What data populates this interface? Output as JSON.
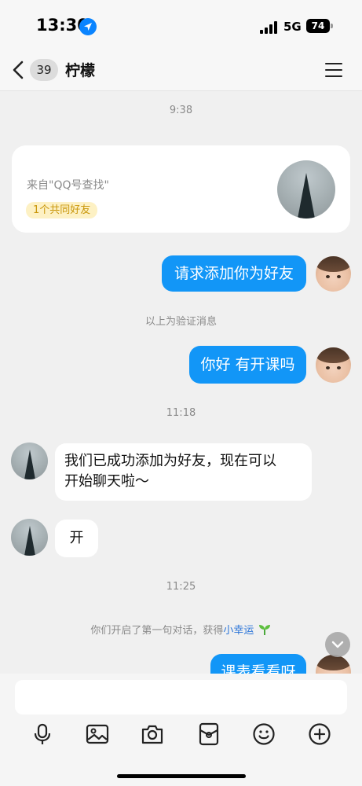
{
  "status_bar": {
    "time": "13:30",
    "network": "5G",
    "battery": "74"
  },
  "nav": {
    "unread_count": "39",
    "title": "柠檬"
  },
  "chat": {
    "timestamps": [
      "9:38",
      "11:18",
      "11:25"
    ],
    "card": {
      "source": "来自\"QQ号查找\"",
      "mutual_friends": "1个共同好友"
    },
    "messages": {
      "request": "请求添加你为好友",
      "verify_note": "以上为验证消息",
      "hello": "你好 有开课吗",
      "added_line1": "我们已成功添加为好友，现在可以",
      "added_line2": "开始聊天啦～",
      "open": "开",
      "first_chat_prefix": "你们开启了第一句对话，获得",
      "first_chat_link": "小幸运",
      "partial": "课表看看呀"
    }
  },
  "icons": {
    "toolbar": [
      "microphone-icon",
      "image-icon",
      "camera-icon",
      "red-packet-icon",
      "emoji-icon",
      "plus-icon"
    ]
  },
  "colors": {
    "accent": "#1296f7",
    "badge_bg": "#fdf1c4",
    "badge_text": "#c9960a",
    "link": "#2a74d8"
  }
}
